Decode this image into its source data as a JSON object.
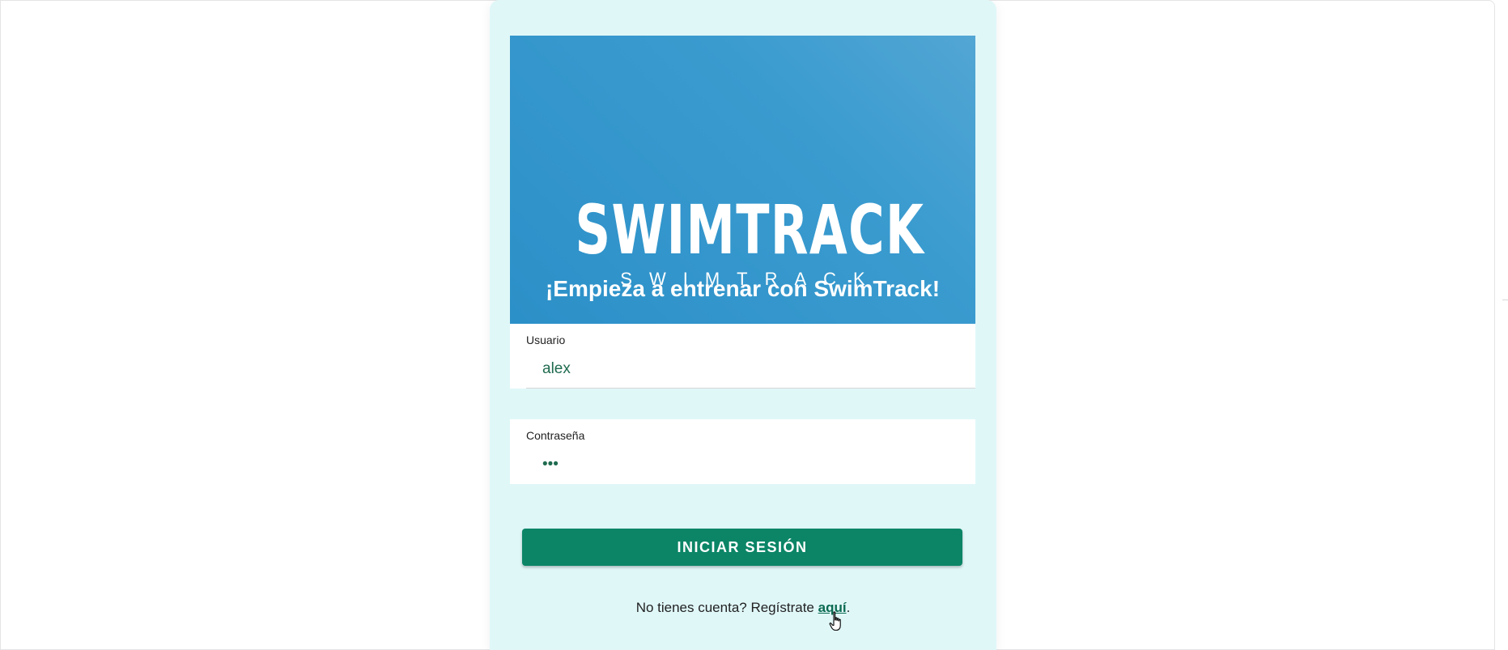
{
  "brand": {
    "logo_main": "SWIMTRACK",
    "logo_sub": "SWIMTRACK",
    "tagline": "¡Empieza a entrenar con SwimTrack!"
  },
  "form": {
    "username": {
      "label": "Usuario",
      "value": "alex"
    },
    "password": {
      "label": "Contraseña",
      "value": "•••"
    },
    "submit_label": "INICIAR SESIÓN"
  },
  "register": {
    "prefix": "No tienes cuenta? Regístrate ",
    "link_text": "aquí",
    "suffix": "."
  },
  "colors": {
    "card_background": "#e0f7f8",
    "hero_blue": "#2c90c8",
    "button_green": "#0b8566",
    "input_text": "#1f6b4f"
  },
  "icons": {
    "cursor": "hand-pointer-icon"
  }
}
